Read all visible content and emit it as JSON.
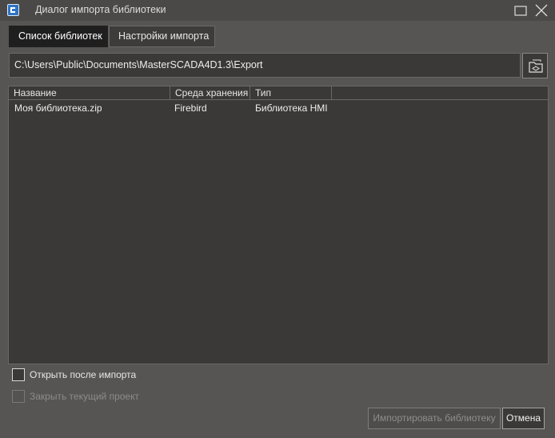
{
  "window": {
    "title": "Диалог импорта библиотеки",
    "icons": {
      "app": "app-logo-icon",
      "maximize": "maximize-icon",
      "close": "close-icon"
    }
  },
  "tabs": [
    {
      "label": "Список библиотек",
      "active": true
    },
    {
      "label": "Настройки импорта",
      "active": false
    }
  ],
  "path": {
    "value": "C:\\Users\\Public\\Documents\\MasterSCADA4D1.3\\Export",
    "browse_icon": "folder-browse-icon"
  },
  "table": {
    "columns": [
      "Название",
      "Среда хранения",
      "Тип"
    ],
    "rows": [
      [
        "Моя библиотека.zip",
        "Firebird",
        "Библиотека HMI"
      ]
    ]
  },
  "options": {
    "open_after_import": {
      "label": "Открыть после импорта",
      "checked": false,
      "enabled": true
    },
    "close_current_project": {
      "label": "Закрыть текущий проект",
      "checked": false,
      "enabled": false
    }
  },
  "buttons": {
    "import": {
      "label": "Импортировать библиотеку",
      "enabled": false
    },
    "cancel": {
      "label": "Отмена",
      "enabled": true
    }
  },
  "colors": {
    "background": "#575553",
    "panel": "#3b3938",
    "active_tab": "#1f1f1f",
    "accent": "#2f74c4"
  }
}
